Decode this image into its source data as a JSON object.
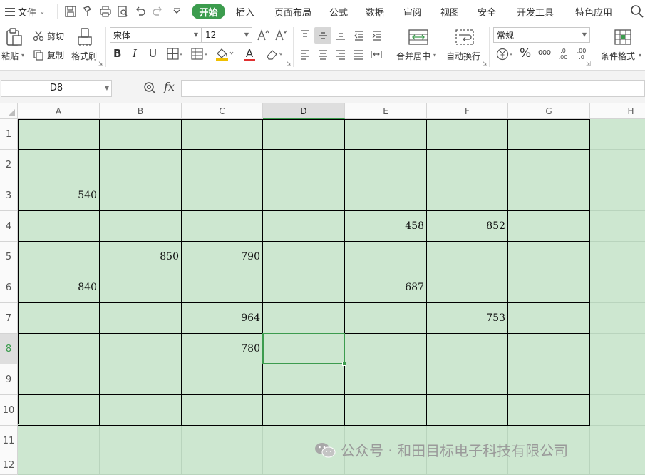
{
  "menubar": {
    "file_label": "文件",
    "tabs": [
      "插入",
      "页面布局",
      "公式",
      "数据",
      "审阅",
      "视图",
      "安全",
      "开发工具",
      "特色应用"
    ],
    "active_tab": "开始"
  },
  "ribbon": {
    "paste_label": "粘贴",
    "cut_label": "剪切",
    "copy_label": "复制",
    "format_painter_label": "格式刷",
    "font_name": "宋体",
    "font_size": "12",
    "merge_label": "合并居中",
    "wrap_label": "自动换行",
    "number_format": "常规",
    "conditional_format_label": "条件格式",
    "bold": "B",
    "italic": "I",
    "underline": "U",
    "font_color_letter": "A",
    "percent": "%",
    "thousands": "000",
    "inc_decimal": ".0\n.00",
    "dec_decimal": ".00\n.0"
  },
  "formula_bar": {
    "cell_ref": "D8",
    "fx": "fx",
    "formula": ""
  },
  "columns": [
    "A",
    "B",
    "C",
    "D",
    "E",
    "F",
    "G",
    "H"
  ],
  "active_column": "D",
  "rows": [
    "1",
    "2",
    "3",
    "4",
    "5",
    "6",
    "7",
    "8",
    "9",
    "10",
    "11",
    "12"
  ],
  "active_row": "8",
  "cells": {
    "A3": "540",
    "A6": "840",
    "B5": "850",
    "C5": "790",
    "C7": "964",
    "C8": "780",
    "E4": "458",
    "E6": "687",
    "F4": "852",
    "F7": "753"
  },
  "selected_cell": "D8",
  "watermark": "公众号 · 和田目标电子科技有限公司",
  "colors": {
    "accent": "#3c9c4e",
    "cell_fill": "#cde7d0"
  }
}
